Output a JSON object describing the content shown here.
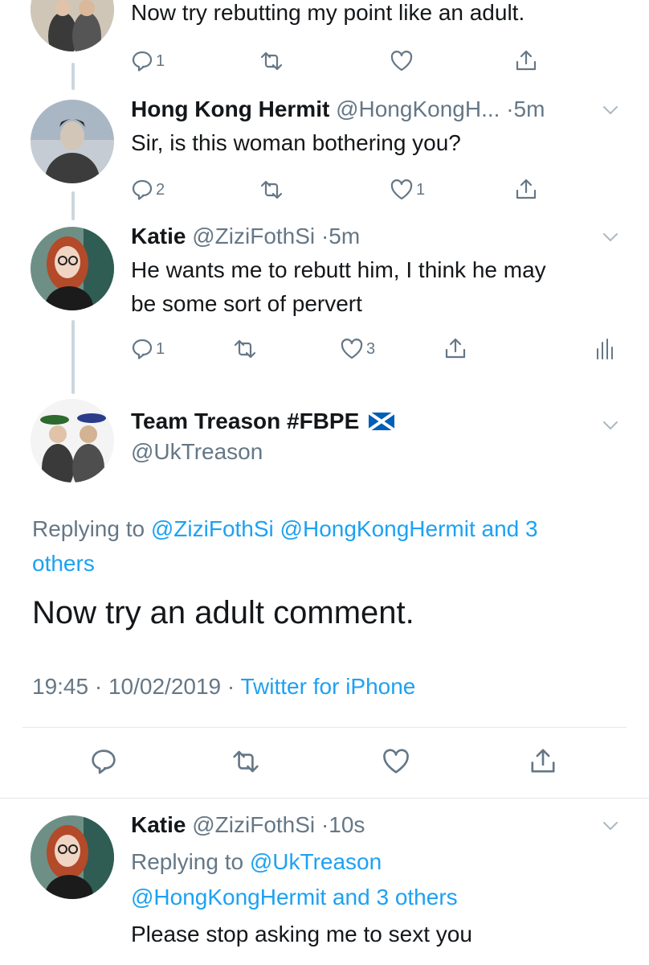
{
  "tweets": [
    {
      "text": "Now try rebutting my point like an adult.",
      "reply_count": "1",
      "like_count": ""
    },
    {
      "name": "Hong Kong Hermit",
      "handle": "@HongKongH...",
      "sep": "·",
      "time": "5m",
      "text": "Sir, is this woman bothering you?",
      "reply_count": "2",
      "like_count": "1"
    },
    {
      "name": "Katie",
      "handle": "@ZiziFothSi",
      "sep": "·",
      "time": "5m",
      "text_lines": [
        "He wants me to rebutt him, I think he may",
        "be some sort of pervert"
      ],
      "reply_count": "1",
      "like_count": "3"
    }
  ],
  "focused": {
    "name": "Team Treason #FBPE",
    "handle": "@UkTreason",
    "replying_prefix": "Replying to",
    "replying_mentions_line1": "@ZiziFothSi @HongKongHermit and 3",
    "replying_mentions_line2": "others",
    "text": "Now try an adult comment.",
    "time": "19:45",
    "sep1": "·",
    "date": "10/02/2019",
    "sep2": "·",
    "source": "Twitter for iPhone"
  },
  "reply": {
    "name": "Katie",
    "handle": "@ZiziFothSi",
    "sep": "·",
    "time": "10s",
    "replying_prefix": "Replying to",
    "replying_line1_mention": "@UkTreason",
    "replying_line2": "@HongKongHermit and 3 others",
    "text": "Please stop asking me to sext you"
  },
  "colors": {
    "accent": "#1da1f2",
    "muted": "#657786",
    "text": "#14171a",
    "thread_line": "#ccd6dd"
  }
}
